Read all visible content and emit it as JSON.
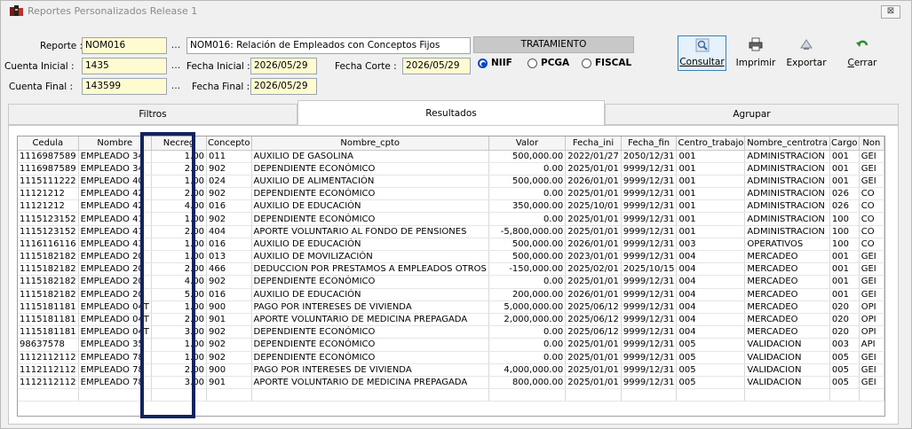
{
  "window": {
    "title": "Reportes Personalizados Release 1",
    "close_label": "⊠"
  },
  "form": {
    "reporte_label": "Reporte :",
    "reporte_value": "NOM016",
    "reporte_desc": "NOM016: Relación de Empleados con Conceptos Fijos",
    "cuenta_inicial_label": "Cuenta Inicial :",
    "cuenta_inicial_value": "1435",
    "cuenta_final_label": "Cuenta Final :",
    "cuenta_final_value": "143599",
    "fecha_inicial_label": "Fecha Inicial :",
    "fecha_inicial_value": "2026/05/29",
    "fecha_corte_label": "Fecha Corte :",
    "fecha_corte_value": "2026/05/29",
    "fecha_final_label": "Fecha Final :",
    "fecha_final_value": "2026/05/29",
    "dots": "..."
  },
  "tratamiento": {
    "label": "TRATAMIENTO",
    "options": [
      {
        "label": "NIIF",
        "selected": true
      },
      {
        "label": "PCGA",
        "selected": false
      },
      {
        "label": "FISCAL",
        "selected": false
      }
    ]
  },
  "toolbar": {
    "consultar": "Consultar",
    "imprimir": "Imprimir",
    "exportar": "Exportar",
    "cerrar": "Cerrar"
  },
  "tabs": [
    {
      "label": "Filtros",
      "active": false
    },
    {
      "label": "Resultados",
      "active": true
    },
    {
      "label": "Agrupar",
      "active": false
    }
  ],
  "grid": {
    "columns": [
      "Cedula",
      "Nombre",
      "Necreg",
      "Concepto",
      "Nombre_cpto",
      "Valor",
      "Fecha_ini",
      "Fecha_fin",
      "Centro_trabajo",
      "Nombre_centrotra",
      "Cargo",
      "Non"
    ],
    "rows": [
      [
        "1116987589",
        "EMPLEADO 34",
        "1.00",
        "011",
        "AUXILIO DE GASOLINA",
        "500,000.00",
        "2022/01/27",
        "2050/12/31",
        "001",
        "ADMINISTRACION",
        "001",
        "GEI"
      ],
      [
        "1116987589",
        "EMPLEADO 34",
        "2.00",
        "902",
        "DEPENDIENTE ECONÓMICO",
        "0.00",
        "2025/01/01",
        "9999/12/31",
        "001",
        "ADMINISTRACION",
        "001",
        "GEI"
      ],
      [
        "1115111222",
        "EMPLEADO 40",
        "1.00",
        "024",
        "AUXILIO DE ALIMENTACIÓN",
        "500,000.00",
        "2026/01/01",
        "9999/12/31",
        "001",
        "ADMINISTRACION",
        "001",
        "GEI"
      ],
      [
        "11121212",
        "EMPLEADO 42",
        "2.00",
        "902",
        "DEPENDIENTE ECONÓMICO",
        "0.00",
        "2025/01/01",
        "9999/12/31",
        "001",
        "ADMINISTRACION",
        "026",
        "CO"
      ],
      [
        "11121212",
        "EMPLEADO 42",
        "4.00",
        "016",
        "AUXILIO DE EDUCACIÓN",
        "350,000.00",
        "2025/10/01",
        "9999/12/31",
        "001",
        "ADMINISTRACION",
        "026",
        "CO"
      ],
      [
        "1115123152",
        "EMPLEADO 41",
        "1.00",
        "902",
        "DEPENDIENTE ECONÓMICO",
        "0.00",
        "2025/01/01",
        "9999/12/31",
        "001",
        "ADMINISTRACION",
        "100",
        "CO"
      ],
      [
        "1115123152",
        "EMPLEADO 41",
        "2.00",
        "404",
        "APORTE VOLUNTARIO AL FONDO DE PENSIONES",
        "-5,800,000.00",
        "2025/01/01",
        "9999/12/31",
        "001",
        "ADMINISTRACION",
        "100",
        "CO"
      ],
      [
        "1116116116",
        "EMPLEADO 43",
        "1.00",
        "016",
        "AUXILIO DE EDUCACIÓN",
        "500,000.00",
        "2026/01/01",
        "9999/12/31",
        "003",
        "OPERATIVOS",
        "100",
        "CO"
      ],
      [
        "1115182182",
        "EMPLEADO 20",
        "1.00",
        "013",
        "AUXILIO DE MOVILIZACIÓN",
        "500,000.00",
        "2023/01/01",
        "9999/12/31",
        "004",
        "MERCADEO",
        "001",
        "GEI"
      ],
      [
        "1115182182",
        "EMPLEADO 20",
        "2.00",
        "466",
        "DEDUCCION POR PRESTAMOS A EMPLEADOS OTROS",
        "-150,000.00",
        "2025/02/01",
        "2025/10/15",
        "004",
        "MERCADEO",
        "001",
        "GEI"
      ],
      [
        "1115182182",
        "EMPLEADO 20",
        "4.00",
        "902",
        "DEPENDIENTE ECONÓMICO",
        "0.00",
        "2025/01/01",
        "9999/12/31",
        "004",
        "MERCADEO",
        "001",
        "GEI"
      ],
      [
        "1115182182",
        "EMPLEADO 20",
        "5.00",
        "016",
        "AUXILIO DE EDUCACIÓN",
        "200,000.00",
        "2026/01/01",
        "9999/12/31",
        "004",
        "MERCADEO",
        "001",
        "GEI"
      ],
      [
        "1115181181",
        "EMPLEADO 04T",
        "1.00",
        "900",
        "PAGO POR INTERESES DE VIVIENDA",
        "5,000,000.00",
        "2025/06/12",
        "9999/12/31",
        "004",
        "MERCADEO",
        "020",
        "OPI"
      ],
      [
        "1115181181",
        "EMPLEADO 04T",
        "2.00",
        "901",
        "APORTE VOLUNTARIO DE MEDICINA PREPAGADA",
        "2,000,000.00",
        "2025/06/12",
        "9999/12/31",
        "004",
        "MERCADEO",
        "020",
        "OPI"
      ],
      [
        "1115181181",
        "EMPLEADO 04T",
        "3.00",
        "902",
        "DEPENDIENTE ECONÓMICO",
        "0.00",
        "2025/06/12",
        "9999/12/31",
        "004",
        "MERCADEO",
        "020",
        "OPI"
      ],
      [
        "98637578",
        "EMPLEADO 35",
        "1.00",
        "902",
        "DEPENDIENTE ECONÓMICO",
        "0.00",
        "2025/01/01",
        "9999/12/31",
        "005",
        "VALIDACION",
        "003",
        "API"
      ],
      [
        "1112112112",
        "EMPLEADO 78",
        "1.00",
        "902",
        "DEPENDIENTE ECONÓMICO",
        "0.00",
        "2025/01/01",
        "9999/12/31",
        "005",
        "VALIDACION",
        "005",
        "GEI"
      ],
      [
        "1112112112",
        "EMPLEADO 78",
        "2.00",
        "900",
        "PAGO POR INTERESES DE VIVIENDA",
        "4,000,000.00",
        "2025/01/01",
        "9999/12/31",
        "005",
        "VALIDACION",
        "005",
        "GEI"
      ],
      [
        "1112112112",
        "EMPLEADO 78",
        "3.00",
        "901",
        "APORTE VOLUNTARIO DE MEDICINA PREPAGADA",
        "800,000.00",
        "2025/01/01",
        "9999/12/31",
        "005",
        "VALIDACION",
        "005",
        "GEI"
      ]
    ]
  },
  "colors": {
    "highlight": "#12235f",
    "field_yellow": "#fffbd1",
    "radio_accent": "#0046c8"
  }
}
